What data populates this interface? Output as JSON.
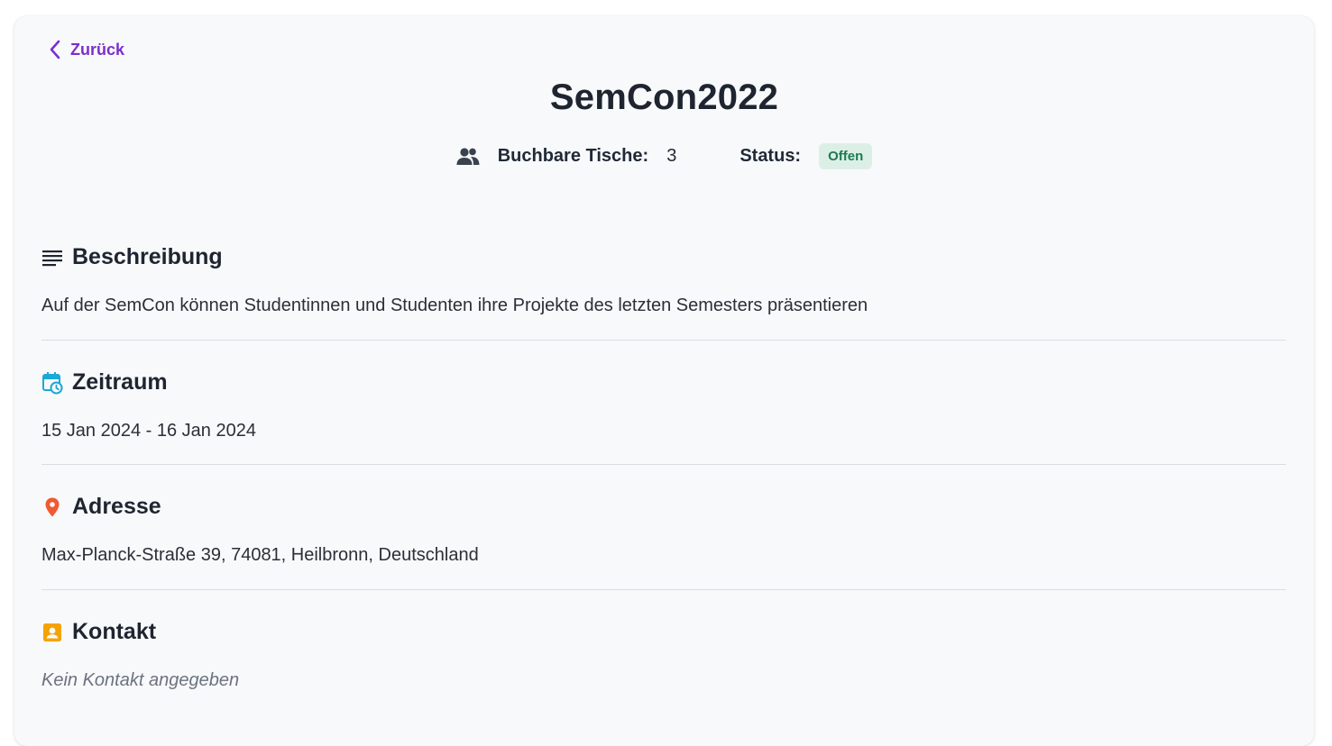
{
  "nav": {
    "back_label": "Zurück",
    "back_icon": "chevron-left-icon"
  },
  "event": {
    "title": "SemCon2022",
    "tables_label": "Buchbare Tische:",
    "tables_value": "3",
    "status_label": "Status:",
    "status_value": "Offen"
  },
  "sections": {
    "description": {
      "heading": "Beschreibung",
      "icon": "notes-icon",
      "text": "Auf der SemCon können Studentinnen und Studenten ihre Projekte des letzten Semesters präsentieren"
    },
    "period": {
      "heading": "Zeitraum",
      "icon": "calendar-clock-icon",
      "text": "15 Jan 2024 - 16 Jan 2024"
    },
    "address": {
      "heading": "Adresse",
      "icon": "location-pin-icon",
      "text": "Max-Planck-Straße 39, 74081, Heilbronn, Deutschland"
    },
    "contact": {
      "heading": "Kontakt",
      "icon": "contact-card-icon",
      "text": "Kein Kontakt angegeben"
    }
  },
  "colors": {
    "accent": "#7b2fcf",
    "status_bg": "#dcefe7",
    "status_fg": "#1d7a4e",
    "calendar_icon": "#1ba9d6",
    "pin_icon": "#f05a30",
    "contact_icon": "#f5a300"
  }
}
